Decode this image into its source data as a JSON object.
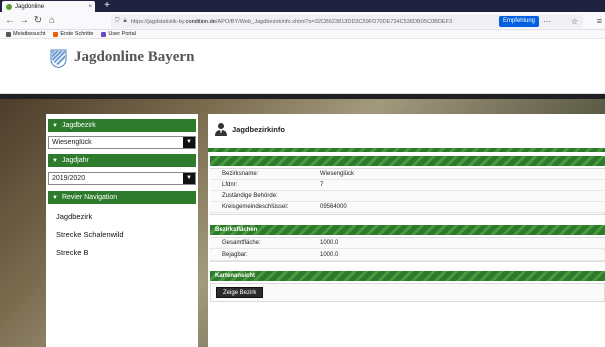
{
  "browser": {
    "tab_title": "Jagdonline",
    "tab_close": "×",
    "new_tab": "+",
    "url_prefix": "https://jagdstatistik-by.",
    "url_domain": "condition.de",
    "url_path": "/APO/BY/Web_JagdbezirkInfo.xhtml?s=32CB623813DD3C59FD70DE734C536DB05C0BDEF3",
    "recommend_label": "Empfehlung",
    "bookmarks": [
      "Meistbesucht",
      "Erste Schritte",
      "User Portal"
    ]
  },
  "site": {
    "title": "Jagdonline Bayern"
  },
  "sidebar": {
    "jagdbezirk_header": "Jagdbezirk",
    "jagdbezirk_value": "Wiesenglück",
    "jagdjahr_header": "Jagdjahr",
    "jagdjahr_value": "2019/2020",
    "nav_header": "Revier Navigation",
    "nav_items": [
      "Jagdbezirk",
      "Strecke Schalenwild",
      "Strecke B"
    ]
  },
  "main": {
    "title": "Jagdbezirkinfo",
    "info_rows": [
      {
        "key": "Bezirksname:",
        "value": "Wiesenglück"
      },
      {
        "key": "Lfdnr:",
        "value": "7"
      },
      {
        "key": "Zuständige Behörde:",
        "value": ""
      },
      {
        "key": "Kreisgemeindeschlüssel:",
        "value": "09564000"
      }
    ],
    "flaechen_header": "Bezirksflächen",
    "flaechen_rows": [
      {
        "key": "Gesamtfläche:",
        "value": "1000.0"
      },
      {
        "key": "Bejagbar:",
        "value": "1000.0"
      }
    ],
    "karten_header": "Kartenansicht",
    "zeige_button": "Zeige Bezirk"
  },
  "colors": {
    "accent_green": "#2e7b2d",
    "tab_strip": "#202340",
    "recommend_blue": "#0060df"
  },
  "icons": [
    "back-icon",
    "forward-icon",
    "reload-icon",
    "home-icon",
    "shield-icon",
    "lock-icon",
    "star-icon",
    "user-avatar-icon",
    "bavaria-crest-icon"
  ]
}
